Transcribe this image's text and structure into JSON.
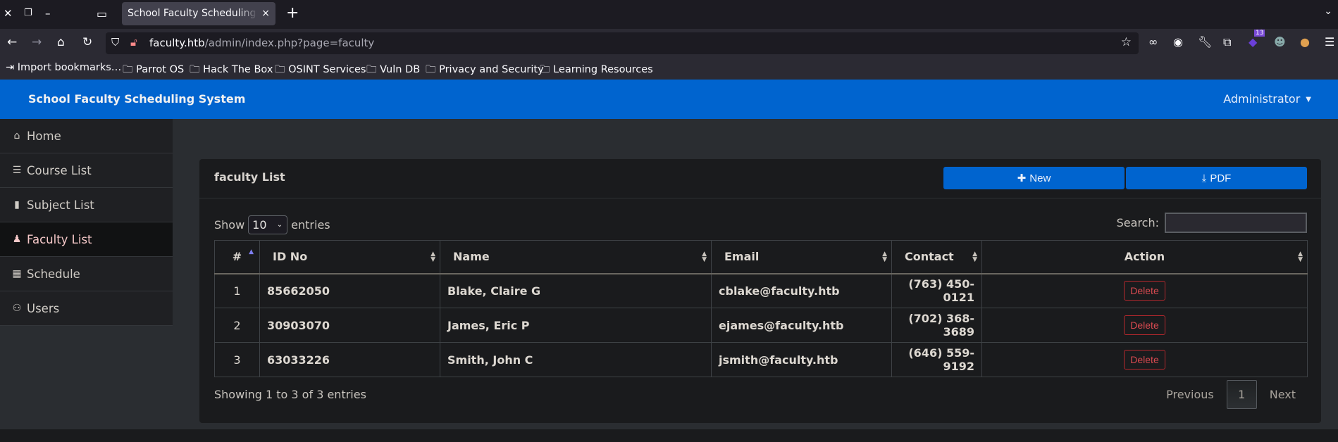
{
  "browser": {
    "tab_title": "School Faculty Scheduling System",
    "tab_close_icon": "×",
    "new_tab_icon": "+",
    "url_host": "faculty.htb",
    "url_path": "/admin/index.php?page=faculty",
    "extension_badge": "13",
    "bookmarks": [
      "Import bookmarks…",
      "Parrot OS",
      "Hack The Box",
      "OSINT Services",
      "Vuln DB",
      "Privacy and Security",
      "Learning Resources"
    ]
  },
  "app": {
    "brand": "School Faculty Scheduling System",
    "user_menu": "Administrator",
    "accent_color": "#0064cf"
  },
  "sidebar": {
    "items": [
      {
        "label": "Home",
        "icon": "home-icon",
        "glyph": "⌂"
      },
      {
        "label": "Course List",
        "icon": "list-icon",
        "glyph": "☰"
      },
      {
        "label": "Subject List",
        "icon": "book-icon",
        "glyph": "▮"
      },
      {
        "label": "Faculty List",
        "icon": "user-tie-icon",
        "glyph": "♟",
        "active": true
      },
      {
        "label": "Schedule",
        "icon": "calendar-icon",
        "glyph": "▦"
      },
      {
        "label": "Users",
        "icon": "users-icon",
        "glyph": "⚇"
      }
    ]
  },
  "card": {
    "title": "faculty List",
    "new_label": "New",
    "pdf_label": "PDF"
  },
  "datatable": {
    "show_label": "Show",
    "entries_label": "entries",
    "page_length": "10",
    "search_label": "Search:",
    "search_value": "",
    "columns": [
      "#",
      "ID No",
      "Name",
      "Email",
      "Contact",
      "Action"
    ],
    "rows": [
      {
        "num": "1",
        "id_no": "85662050",
        "name": "Blake, Claire G",
        "email": "cblake@faculty.htb",
        "contact": "(763) 450-0121",
        "action": "Delete"
      },
      {
        "num": "2",
        "id_no": "30903070",
        "name": "James, Eric P",
        "email": "ejames@faculty.htb",
        "contact": "(702) 368-3689",
        "action": "Delete"
      },
      {
        "num": "3",
        "id_no": "63033226",
        "name": "Smith, John C",
        "email": "jsmith@faculty.htb",
        "contact": "(646) 559-9192",
        "action": "Delete"
      }
    ],
    "info": "Showing 1 to 3 of 3 entries",
    "previous_label": "Previous",
    "current_page": "1",
    "next_label": "Next"
  }
}
